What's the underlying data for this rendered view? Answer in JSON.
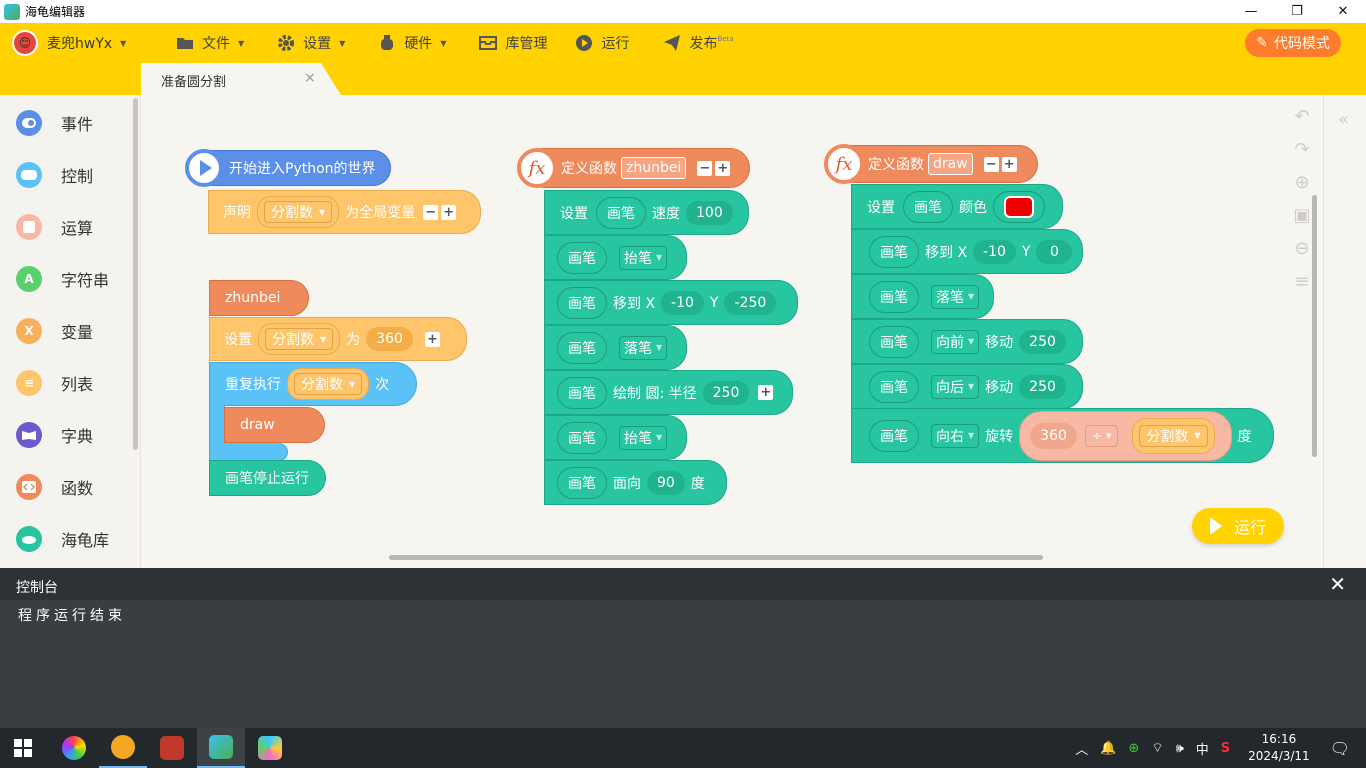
{
  "window": {
    "title": "海龟编辑器",
    "controls": [
      "—",
      "❐",
      "✕"
    ]
  },
  "menubar": {
    "user": "麦兜hwYx",
    "items": [
      {
        "label": "文件",
        "icon": "folder-icon",
        "caret": true
      },
      {
        "label": "设置",
        "icon": "gear-icon",
        "caret": true
      },
      {
        "label": "硬件",
        "icon": "robot-icon",
        "caret": true
      },
      {
        "label": "库管理",
        "icon": "box-icon",
        "caret": false
      },
      {
        "label": "运行",
        "icon": "play-circle-icon",
        "caret": false
      },
      {
        "label": "发布",
        "icon": "paper-plane-icon",
        "caret": false,
        "badge": "Beta"
      }
    ],
    "code_mode": "代码模式"
  },
  "tab": {
    "label": "准备圆分割",
    "close": "×"
  },
  "sidebar": {
    "categories": [
      {
        "label": "事件",
        "color": "#5b8fe8",
        "icon": "toggle-icon"
      },
      {
        "label": "控制",
        "color": "#5ac2f7",
        "icon": "gamepad-icon"
      },
      {
        "label": "运算",
        "color": "#f7b8a4",
        "icon": "calculator-icon"
      },
      {
        "label": "字符串",
        "color": "#5ad06d",
        "icon": "letter-a-icon"
      },
      {
        "label": "变量",
        "color": "#f6b15a",
        "icon": "letter-x-icon"
      },
      {
        "label": "列表",
        "color": "#fec56b",
        "icon": "list-icon"
      },
      {
        "label": "字典",
        "color": "#6a5acd",
        "icon": "book-icon"
      },
      {
        "label": "函数",
        "color": "#ef8a5c",
        "icon": "code-icon"
      },
      {
        "label": "海龟库",
        "color": "#27c5a0",
        "icon": "turtle-icon"
      }
    ]
  },
  "blocks": {
    "start": "开始进入Python的世界",
    "declare": {
      "label": "声明",
      "var": "分割数",
      "suffix": "为全局变量"
    },
    "call_zhunbei": "zhunbei",
    "set_var": {
      "label": "设置",
      "var": "分割数",
      "to": "为",
      "value": "360"
    },
    "repeat": {
      "label": "重复执行",
      "var": "分割数",
      "suffix": "次"
    },
    "call_draw": "draw",
    "stop": "画笔停止运行",
    "def1": {
      "label": "定义函数",
      "name": "zhunbei",
      "body": [
        {
          "a": "设置",
          "b": "画笔",
          "c": "速度",
          "v": "100"
        },
        {
          "a": "画笔",
          "dd": "抬笔"
        },
        {
          "a": "画笔",
          "c": "移到 X",
          "x": "-10",
          "y_label": "Y",
          "y": "-250"
        },
        {
          "a": "画笔",
          "dd": "落笔"
        },
        {
          "a": "画笔",
          "c": "绘制 圆: 半径",
          "v": "250"
        },
        {
          "a": "画笔",
          "dd": "抬笔"
        },
        {
          "a": "画笔",
          "c": "面向",
          "v": "90",
          "suffix": "度"
        }
      ]
    },
    "def2": {
      "label": "定义函数",
      "name": "draw",
      "body": [
        {
          "a": "设置",
          "b": "画笔",
          "c": "颜色",
          "color": "#ee0000"
        },
        {
          "a": "画笔",
          "c": "移到 X",
          "x": "-10",
          "y_label": "Y",
          "y": "0"
        },
        {
          "a": "画笔",
          "dd": "落笔"
        },
        {
          "a": "画笔",
          "dd": "向前",
          "c": "移动",
          "v": "250"
        },
        {
          "a": "画笔",
          "dd": "向后",
          "c": "移动",
          "v": "250"
        },
        {
          "a": "画笔",
          "dd": "向右",
          "c": "旋转",
          "num": "360",
          "op": "÷",
          "var": "分割数",
          "suffix": "度"
        }
      ]
    }
  },
  "run_button": "运行",
  "console": {
    "title": "控制台",
    "output": "程序运行结束"
  },
  "taskbar": {
    "time": "16:16",
    "date": "2024/3/11",
    "ime": "中"
  }
}
